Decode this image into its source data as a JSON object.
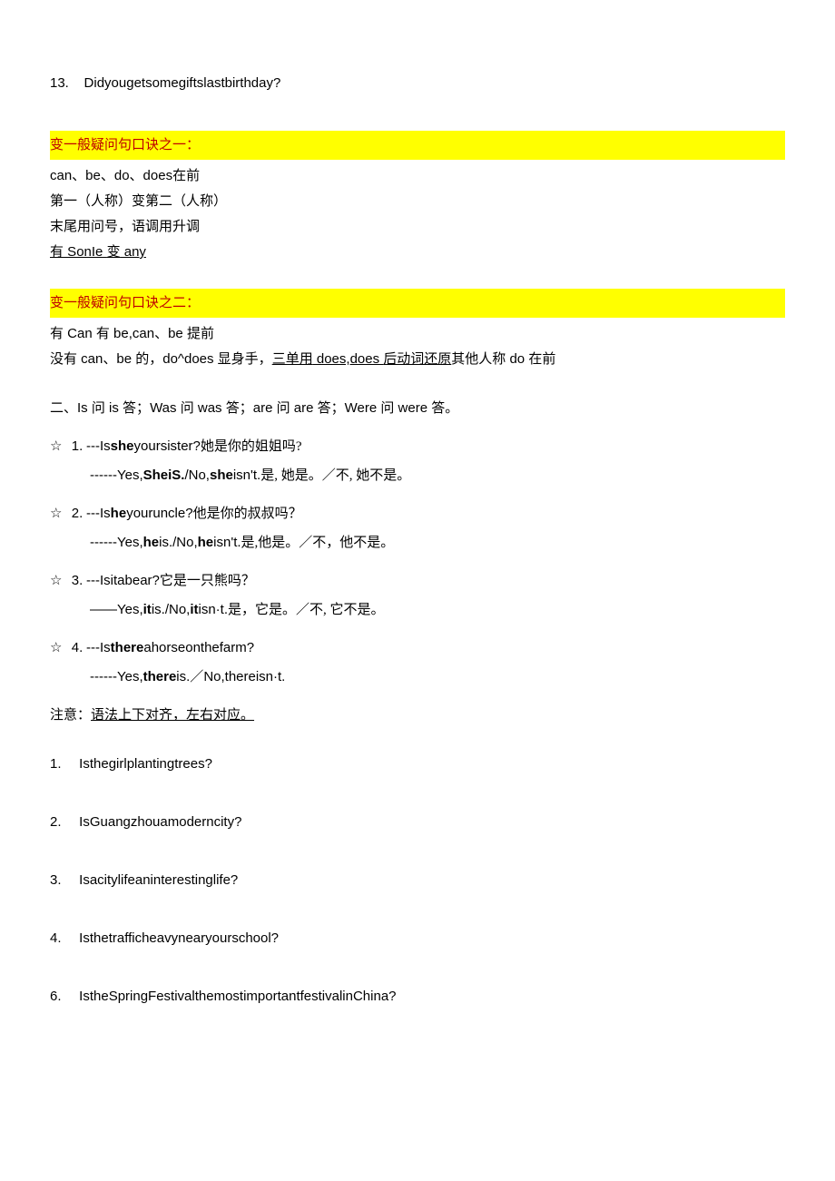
{
  "top_q": {
    "num": "13.",
    "text": "Didyougetsomegiftslastbirthday?"
  },
  "rule1": {
    "title": "变一般疑问句口诀之一：",
    "line1_pre": "can、be、do、does",
    "line1_post": "在前",
    "line2": "第一（人称）变第二（人称）",
    "line3": "末尾用问号，语调用升调",
    "line4_pre": "有",
    "line4_mid": " SonIe ",
    "line4_post": "变",
    "line4_end": " any"
  },
  "rule2": {
    "title": "变一般疑问句口诀之二：",
    "line1_a": "有",
    "line1_b": " Can ",
    "line1_c": "有",
    "line1_d": " be,can、be ",
    "line1_e": "提前",
    "line2_a": "没有",
    "line2_b": " can、be ",
    "line2_c": "的，",
    "line2_d": "do^does ",
    "line2_e": "显身手，",
    "line2_u1": "三单用",
    "line2_u2": " does,does ",
    "line2_u3": "后动词还原",
    "line2_f": "其他人称",
    "line2_g": " do ",
    "line2_h": "在前"
  },
  "section2_intro": {
    "a": "二、",
    "b": "Is ",
    "c": "问",
    "d": " is ",
    "e": "答；",
    "f": "Was ",
    "g": "问",
    "h": " was ",
    "i": "答；",
    "j": "are ",
    "k": "问",
    "l": " are ",
    "m": "答；",
    "n": "Were ",
    "o": "问",
    "p": " were ",
    "q": "答。"
  },
  "examples": [
    {
      "star": "☆",
      "num": "1.",
      "q_pre": "---Is",
      "q_bold": "she",
      "q_post": "yoursister?",
      "q_cn": "她是你的姐姐吗?",
      "a_pre": "------Yes,",
      "a_b1": "SheiS.",
      "a_mid": "/No,",
      "a_b2": "she",
      "a_post": "isn't.",
      "a_cn": "是, 她是。／不, 她不是。"
    },
    {
      "star": "☆",
      "num": "2.",
      "q_pre": "---Is",
      "q_bold": "he",
      "q_post": "youruncle?",
      "q_cn": "他是你的叔叔吗？",
      "a_pre": "------Yes,",
      "a_b1": "he",
      "a_mid1": "is./No,",
      "a_b2": "he",
      "a_post": "isn't.",
      "a_cn": "是,他是。／不，他不是。"
    },
    {
      "star": "☆",
      "num": "3.",
      "q_pre": "---Isitabear?",
      "q_cn": "它是一只熊吗？",
      "a_pre": "——Yes,",
      "a_b1": "it",
      "a_mid1": "is./No,",
      "a_b2": "it",
      "a_post": "isn·t.",
      "a_cn": "是，它是。／不, 它不是。"
    },
    {
      "star": "☆",
      "num": "4.",
      "q_pre": "---Is",
      "q_bold": "there",
      "q_post": "ahorseonthefarm?",
      "a_pre": "------Yes,",
      "a_b1": "there",
      "a_mid1": "is.",
      "a_slash": "／",
      "a_post": "No,thereisn·t."
    }
  ],
  "note": {
    "label": "注意：",
    "text": "语法上下对齐，左右对应。"
  },
  "bottom_list": [
    {
      "num": "1.",
      "text": "Isthegirlplantingtrees?"
    },
    {
      "num": "2.",
      "text": "IsGuangzhouamoderncity?"
    },
    {
      "num": "3.",
      "text": "Isacitylifeaninterestinglife?"
    },
    {
      "num": "4.",
      "text": "Isthetrafficheavynearyourschool?"
    },
    {
      "num": "6.",
      "text": "IstheSpringFestivalthemostimportantfestivalinChina?"
    }
  ]
}
